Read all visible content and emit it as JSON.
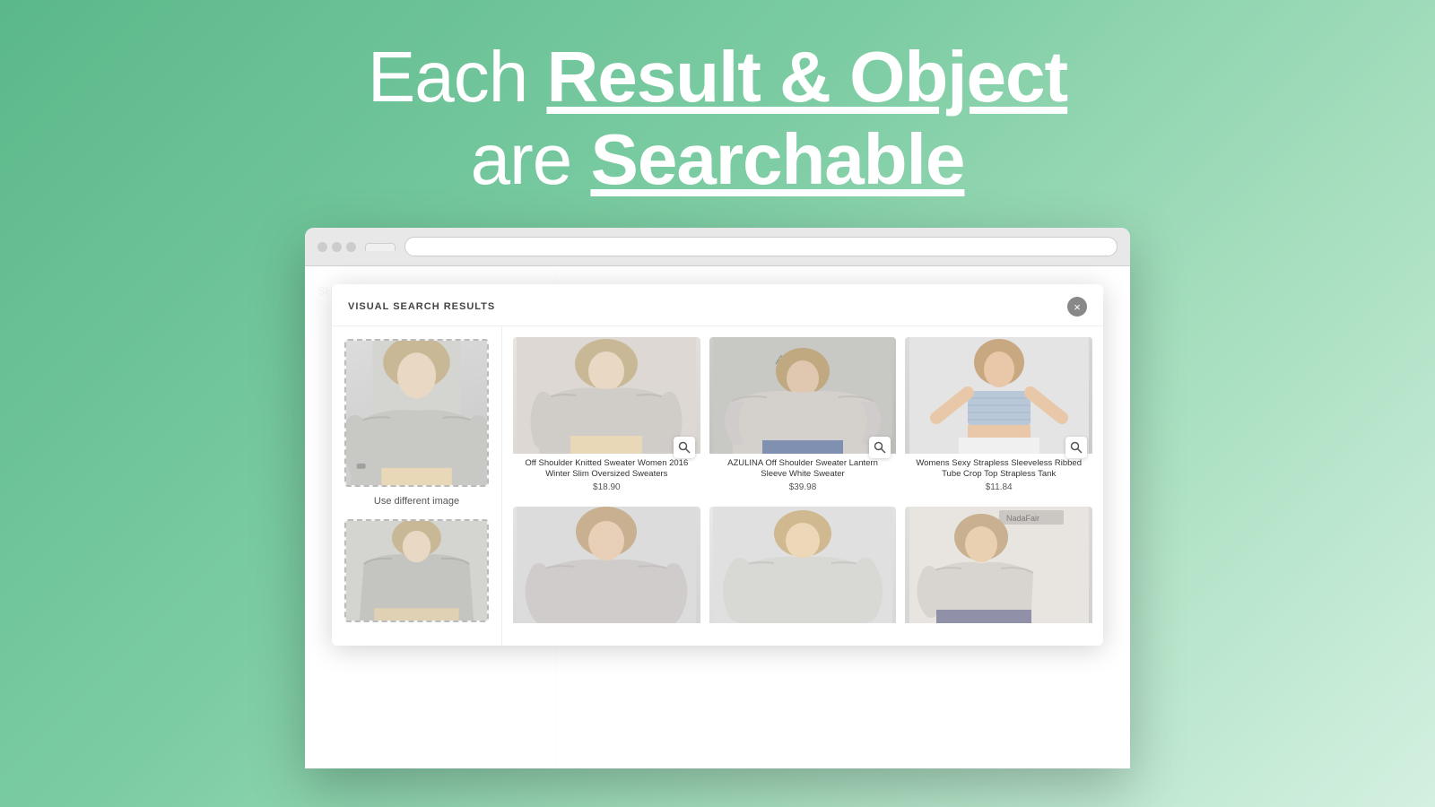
{
  "background_color": "#5bb88a",
  "headline": {
    "line1_prefix": "Each ",
    "line1_bold": "Result & Object",
    "line2_prefix": "are ",
    "line2_bold": "Searchable"
  },
  "browser": {
    "url_bar_placeholder": "",
    "tab_label": "",
    "brand": "SHOPIX VISUAL"
  },
  "modal": {
    "title": "VISUAL SEARCH RESULTS",
    "close_button": "×",
    "use_different_image": "Use different image"
  },
  "products": [
    {
      "id": 1,
      "title": "Off Shoulder Knitted Sweater Women 2016 Winter Slim Oversized Sweaters",
      "price": "$18.90",
      "img_class": "prod-img-1"
    },
    {
      "id": 2,
      "title": "AZULINA Off Shoulder Sweater Lantern Sleeve White Sweater",
      "price": "$39.98",
      "img_class": "prod-img-2"
    },
    {
      "id": 3,
      "title": "Womens Sexy Strapless Sleeveless Ribbed Tube Crop Top Strapless Tank",
      "price": "$11.84",
      "img_class": "prod-img-3"
    },
    {
      "id": 4,
      "title": "",
      "price": "",
      "img_class": "prod-img-4"
    },
    {
      "id": 5,
      "title": "",
      "price": "",
      "img_class": "prod-img-5"
    },
    {
      "id": 6,
      "title": "",
      "price": "",
      "img_class": "prod-img-6"
    }
  ]
}
